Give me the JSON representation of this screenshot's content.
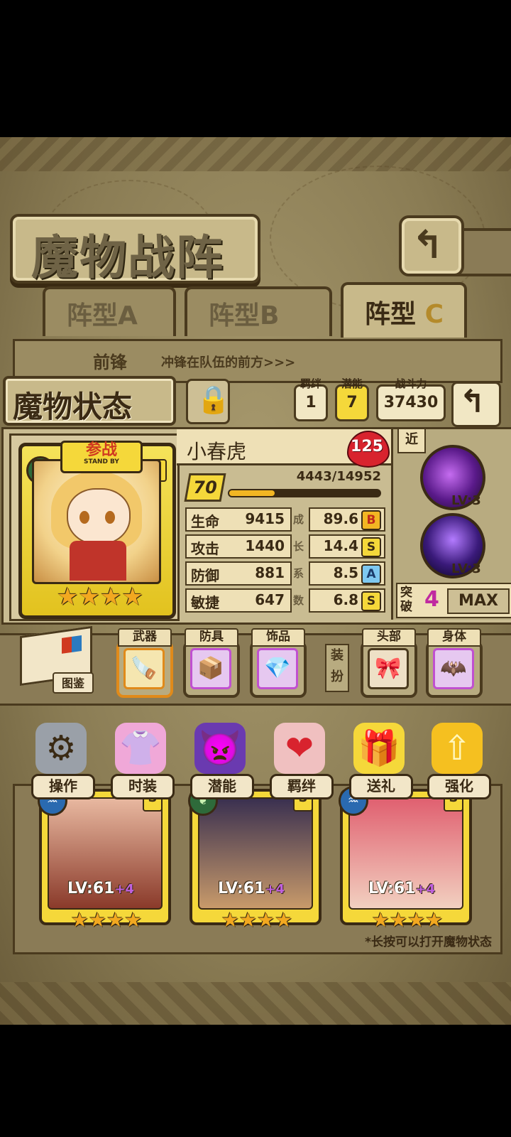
{
  "header": {
    "title": "魔物战阵",
    "back_icon": "return-arrow-icon"
  },
  "formation_tabs": [
    {
      "label": "阵型A",
      "active": false
    },
    {
      "label": "阵型B",
      "active": false
    },
    {
      "label": "阵型",
      "suffix": "C",
      "active": true
    }
  ],
  "frontline": {
    "label": "前锋",
    "description": "冲锋在队伍的前方>>>"
  },
  "status": {
    "title": "魔物状态",
    "bond": {
      "caption": "羁绊",
      "value": "1"
    },
    "potential": {
      "caption": "潜能",
      "value": "7"
    },
    "power": {
      "caption": "战斗力",
      "value": "37430"
    }
  },
  "monster": {
    "badge": "参战",
    "badge_sub": "STAND BY",
    "rank": "S",
    "name": "小春虎",
    "hearts": "125",
    "level": "70",
    "exp": "4443/14952",
    "exp_fraction": 0.297,
    "stars": "★★★★",
    "stats": [
      {
        "label": "生命",
        "value": "9415",
        "growth": "89.6",
        "grade": "B"
      },
      {
        "label": "攻击",
        "value": "1440",
        "growth": "14.4",
        "grade": "S"
      },
      {
        "label": "防御",
        "value": "881",
        "growth": "8.5",
        "grade": "A"
      },
      {
        "label": "敏捷",
        "value": "647",
        "growth": "6.8",
        "grade": "S"
      }
    ],
    "growth_label": [
      "成",
      "长",
      "系",
      "数"
    ],
    "range": "近",
    "skills": [
      {
        "level": "LV:3"
      },
      {
        "level": "LV:3"
      }
    ],
    "breakthrough": {
      "label": "突破",
      "value": "4",
      "max_label": "MAX"
    }
  },
  "equipment": {
    "encyclopedia_label": "图鉴",
    "slots": [
      {
        "label": "武器",
        "icon": "🪚"
      },
      {
        "label": "防具",
        "icon": "📦"
      },
      {
        "label": "饰品",
        "icon": "💎"
      }
    ],
    "dress_label": "装扮",
    "dress_slots": [
      {
        "label": "头部",
        "icon": "🎀"
      },
      {
        "label": "身体",
        "icon": "🦇"
      }
    ]
  },
  "actions": [
    {
      "label": "操作",
      "icon": "⚙"
    },
    {
      "label": "时装",
      "icon": "👚"
    },
    {
      "label": "潜能",
      "icon": "👿"
    },
    {
      "label": "羁绊",
      "icon": "❤"
    },
    {
      "label": "送礼",
      "icon": "🎁"
    },
    {
      "label": "强化",
      "icon": "⇧"
    }
  ],
  "team": [
    {
      "level": "LV:61",
      "plus": "+4",
      "rank": "S",
      "stars": "★★★★",
      "element": "♒"
    },
    {
      "level": "LV:61",
      "plus": "+4",
      "rank": "S",
      "stars": "★★★★",
      "element": "❦"
    },
    {
      "level": "LV:61",
      "plus": "+4",
      "rank": "S",
      "stars": "★★★★",
      "element": "♒"
    }
  ],
  "hint": "*长按可以打开魔物状态"
}
